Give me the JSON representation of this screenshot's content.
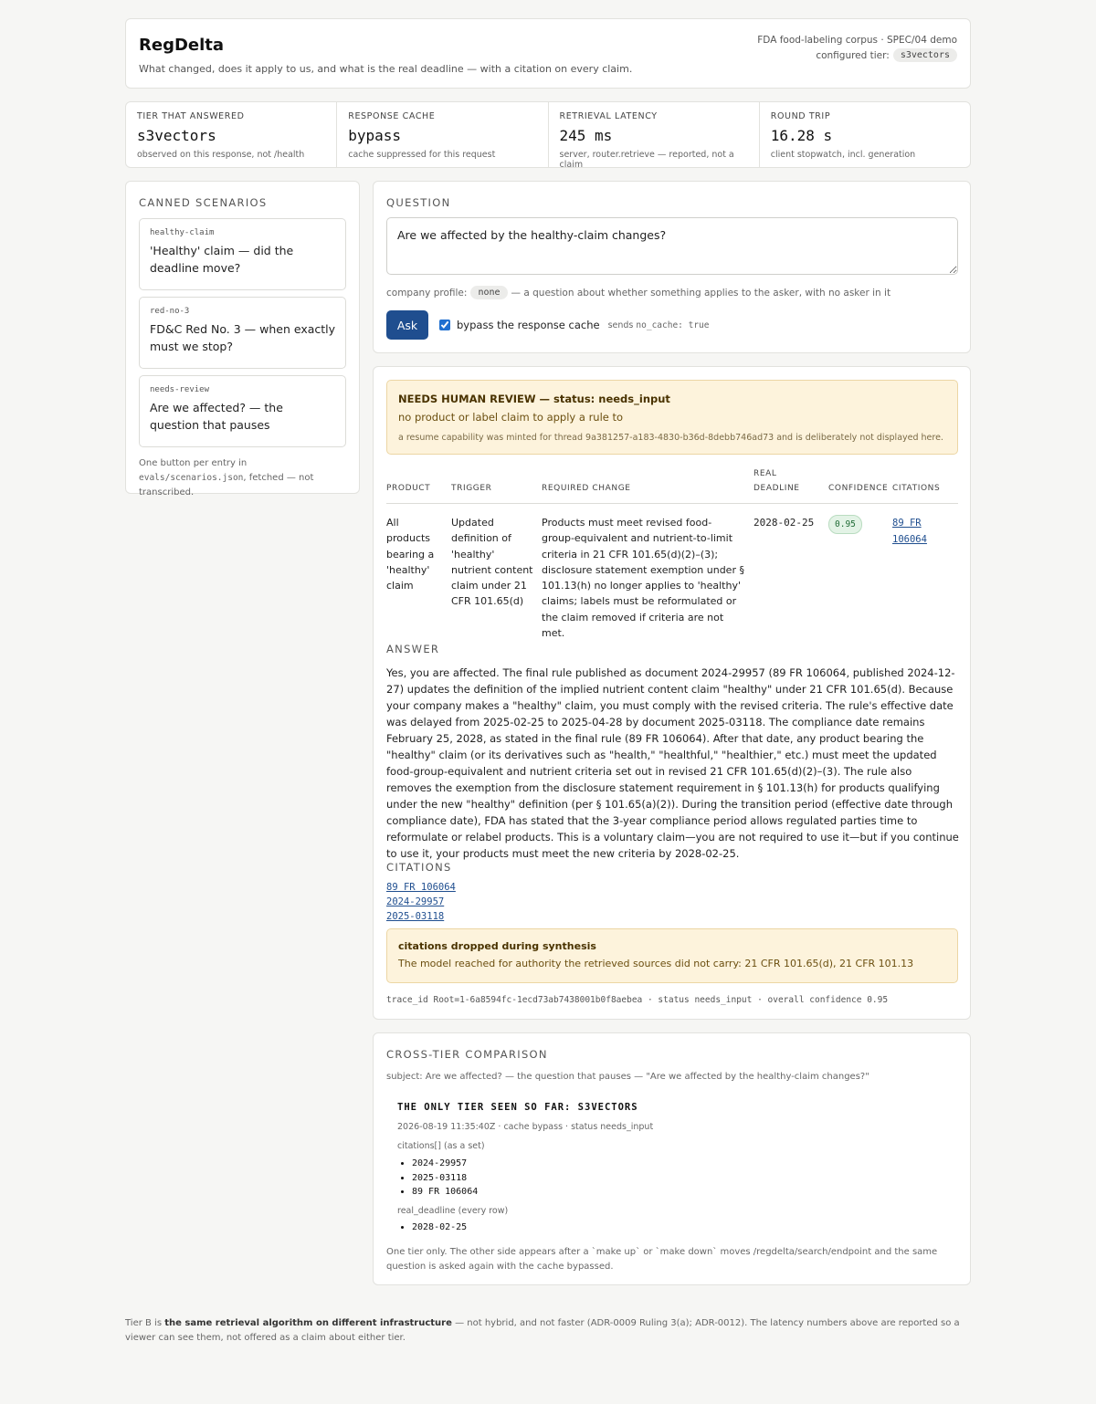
{
  "header": {
    "title": "RegDelta",
    "subtitle": "What changed, does it apply to us, and what is the real deadline — with a citation on every claim.",
    "corpus": "FDA food-labeling corpus · SPEC/04 demo",
    "configured_tier_label": "configured tier:",
    "configured_tier": "s3vectors"
  },
  "stats": [
    {
      "key": "TIER THAT ANSWERED",
      "value": "s3vectors",
      "note": "observed on this response, not /health"
    },
    {
      "key": "RESPONSE CACHE",
      "value": "bypass",
      "note": "cache suppressed for this request"
    },
    {
      "key": "RETRIEVAL LATENCY",
      "value": "245 ms",
      "note": "server, router.retrieve — reported, not a claim"
    },
    {
      "key": "ROUND TRIP",
      "value": "16.28 s",
      "note": "client stopwatch, incl. generation"
    }
  ],
  "scenarios": {
    "heading": "CANNED SCENARIOS",
    "items": [
      {
        "id": "healthy-claim",
        "title": "'Healthy' claim — did the deadline move?"
      },
      {
        "id": "red-no-3",
        "title": "FD&C Red No. 3 — when exactly must we stop?"
      },
      {
        "id": "needs-review",
        "title": "Are we affected? — the question that pauses"
      }
    ],
    "footer_pre": "One button per entry in ",
    "footer_file": "evals/scenarios.json",
    "footer_post": ", fetched — not transcribed."
  },
  "question": {
    "heading": "QUESTION",
    "value": "Are we affected by the healthy-claim changes?",
    "profile_label": "company profile:",
    "profile_value": "none",
    "profile_note": "— a question about whether something applies to the asker, with no asker in it",
    "ask_label": "Ask",
    "bypass_label": "bypass the response cache",
    "sends_label": "sends",
    "sends_value": "no_cache: true",
    "bypass_checked": true
  },
  "result": {
    "review_heading": "NEEDS HUMAN REVIEW — status: needs_input",
    "review_reason": "no product or label claim to apply a rule to",
    "review_caption": "a resume capability was minted for thread 9a381257-a183-4830-b36d-8debb746ad73 and is deliberately not displayed here.",
    "columns": [
      "PRODUCT",
      "TRIGGER",
      "REQUIRED CHANGE",
      "REAL DEADLINE",
      "CONFIDENCE",
      "CITATIONS"
    ],
    "rows": [
      {
        "product": "All products bearing a 'healthy' claim",
        "trigger": "Updated definition of 'healthy' nutrient content claim under 21 CFR 101.65(d)",
        "required_change": "Products must meet revised food-group-equivalent and nutrient-to-limit criteria in 21 CFR 101.65(d)(2)–(3); disclosure statement exemption under § 101.13(h) no longer applies to 'healthy' claims; labels must be reformulated or the claim removed if criteria are not met.",
        "deadline": "2028-02-25",
        "confidence": "0.95",
        "citation": "89 FR 106064"
      }
    ],
    "answer_heading": "ANSWER",
    "answer": "Yes, you are affected. The final rule published as document 2024-29957 (89 FR 106064, published 2024-12-27) updates the definition of the implied nutrient content claim \"healthy\" under 21 CFR 101.65(d). Because your company makes a \"healthy\" claim, you must comply with the revised criteria. The rule's effective date was delayed from 2025-02-25 to 2025-04-28 by document 2025-03118. The compliance date remains February 25, 2028, as stated in the final rule (89 FR 106064). After that date, any product bearing the \"healthy\" claim (or its derivatives such as \"health,\" \"healthful,\" \"healthier,\" etc.) must meet the updated food-group-equivalent and nutrient criteria set out in revised 21 CFR 101.65(d)(2)–(3). The rule also removes the exemption from the disclosure statement requirement in § 101.13(h) for products qualifying under the new \"healthy\" definition (per § 101.65(a)(2)). During the transition period (effective date through compliance date), FDA has stated that the 3-year compliance period allows regulated parties time to reformulate or relabel products. This is a voluntary claim—you are not required to use it—but if you continue to use it, your products must meet the new criteria by 2028-02-25.",
    "citations_heading": "CITATIONS",
    "citations": [
      "89 FR 106064",
      "2024-29957",
      "2025-03118"
    ],
    "dropped_heading": "citations dropped during synthesis",
    "dropped_text": "The model reached for authority the retrieved sources did not carry: 21 CFR 101.65(d), 21 CFR 101.13",
    "trace": "trace_id Root=1-6a8594fc-1ecd73ab7438001b0f8aebea · status needs_input · overall confidence 0.95"
  },
  "cross": {
    "heading": "CROSS-TIER COMPARISON",
    "subject": "subject: Are we affected? — the question that pauses — \"Are we affected by the healthy-claim changes?\"",
    "tier_heading": "THE ONLY TIER SEEN SO FAR: S3VECTORS",
    "meta": "2026-08-19 11:35:40Z · cache bypass · status needs_input",
    "citations_label": "citations[] (as a set)",
    "citations": [
      "2024-29957",
      "2025-03118",
      "89 FR 106064"
    ],
    "deadline_label": "real_deadline (every row)",
    "deadlines": [
      "2028-02-25"
    ],
    "note": "One tier only. The other side appears after a `make up` or `make down` moves /regdelta/search/endpoint and the same question is asked again with the cache bypassed."
  },
  "footer": {
    "pre": "Tier B is ",
    "bold": "the same retrieval algorithm on different infrastructure",
    "post": " — not hybrid, and not faster (ADR-0009 Ruling 3(a); ADR-0012). The latency numbers above are reported so a viewer can see them, not offered as a claim about either tier."
  },
  "colors": {
    "accent": "#1f4e8f",
    "warning_bg": "#fdf3dc",
    "confidence_bg": "#e3f3e6"
  }
}
